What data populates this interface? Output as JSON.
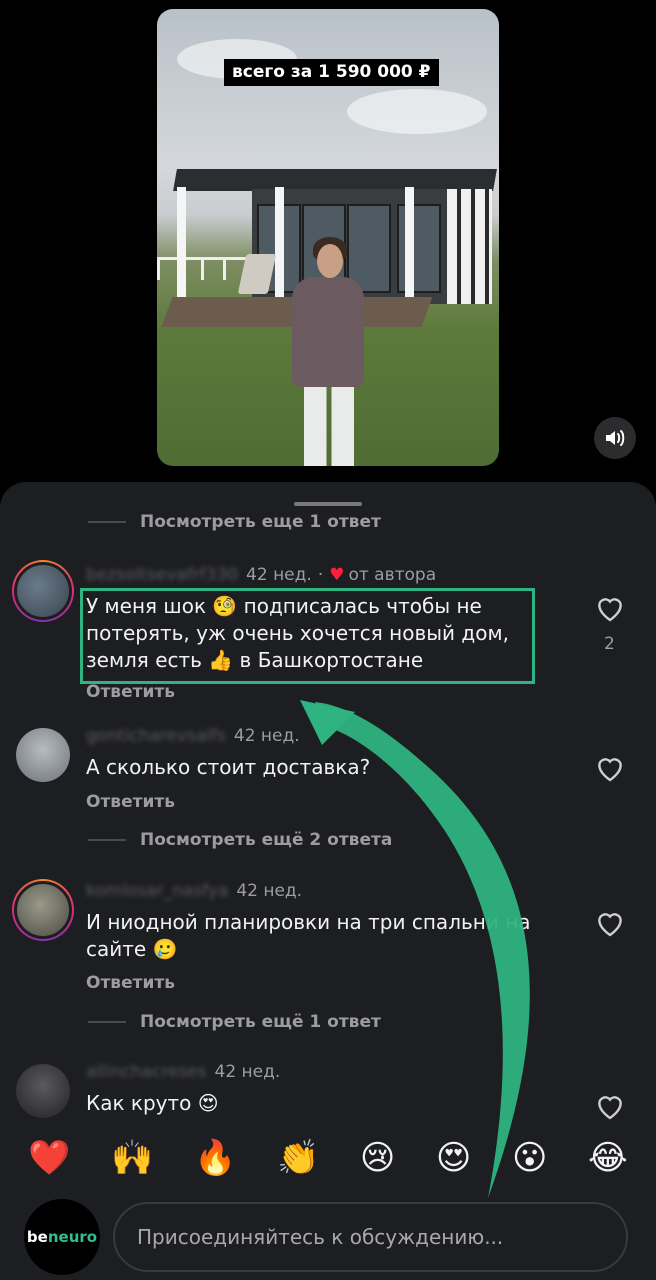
{
  "video": {
    "caption": "всего за 1 590 000 ₽"
  },
  "thread": {
    "top_replies_label": "Посмотреть еще 1 ответ"
  },
  "comments": [
    {
      "username": "bezsoltsevafrf330",
      "time": "42 нед.",
      "author_label": "от автора",
      "text": "У меня шок 🧐 подписалась чтобы не потерять, уж очень хочется новый дом, земля есть 👍 в Башкортостане",
      "reply": "Ответить",
      "likes": "2",
      "liked_by_author": true
    },
    {
      "username": "gonticharevsalfs",
      "time": "42 нед.",
      "text": "А сколько стоит доставка?",
      "reply": "Ответить",
      "more_replies": "Посмотреть ещё 2 ответа"
    },
    {
      "username": "komlosar_nasfya",
      "time": "42 нед.",
      "text": "И ниодной планировки на три спальни на сайте 🥲",
      "reply": "Ответить",
      "more_replies": "Посмотреть ещё 1 ответ"
    },
    {
      "username": "allinchacreses",
      "time": "42 нед.",
      "text": "Как круто 😍"
    }
  ],
  "emoji_bar": [
    "❤️",
    "🙌",
    "🔥",
    "👏",
    "😢",
    "😍",
    "😮",
    "😂"
  ],
  "brand": {
    "part1": "be",
    "part2": "neuro"
  },
  "input": {
    "placeholder": "Присоединяйтесь к обсуждению..."
  },
  "colors": {
    "accent_green": "#2fb380",
    "sheet_bg": "#1d1e22",
    "heart_red": "#ff1f3c"
  }
}
